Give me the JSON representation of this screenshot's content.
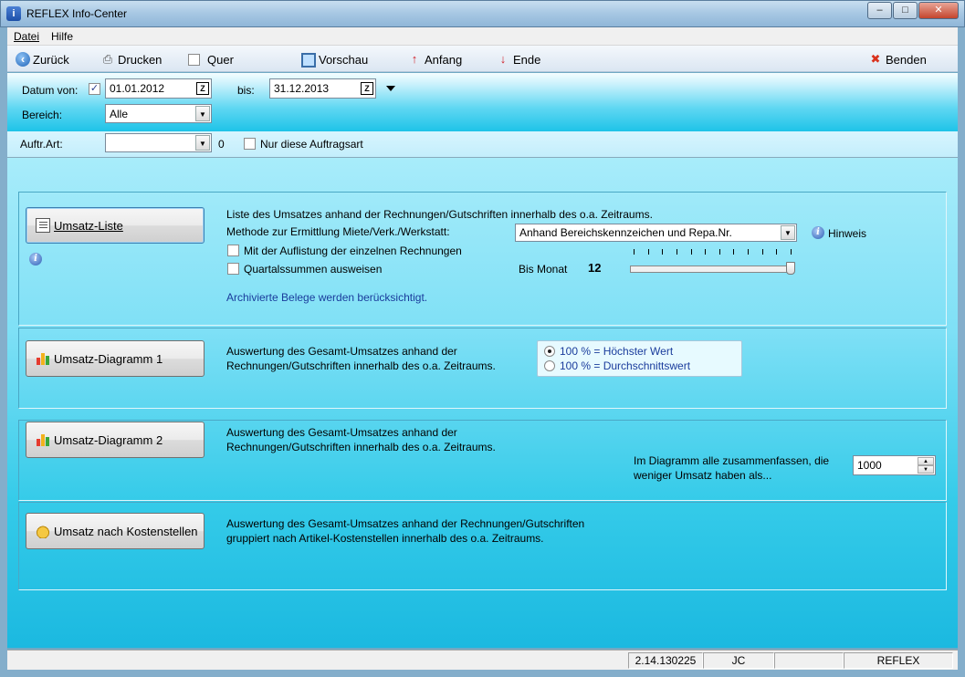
{
  "window": {
    "title": "REFLEX Info-Center",
    "icon_letter": "i",
    "controls": {
      "minimize": "–",
      "maximize": "□",
      "close": "✕"
    }
  },
  "menu": {
    "datei": "Datei",
    "hilfe": "Hilfe"
  },
  "toolbar": {
    "zurueck": "Zurück",
    "drucken": "Drucken",
    "quer": "Quer",
    "vorschau": "Vorschau",
    "anfang": "Anfang",
    "ende": "Ende",
    "benden": "Benden"
  },
  "filter": {
    "datum_von_label": "Datum von:",
    "datum_von_checked": "✓",
    "datum_von_value": "01.01.2012",
    "bis_label": "bis:",
    "bis_value": "31.12.2013",
    "cal_btn": "Z",
    "bereich_label": "Bereich:",
    "bereich_value": "Alle",
    "auftr_art_label": "Auftr.Art:",
    "auftr_art_value": "",
    "auftr_art_count": "0",
    "nur_diese_label": "Nur diese Auftragsart"
  },
  "sections": {
    "umsatz_liste": {
      "button": "Umsatz-Liste",
      "desc": "Liste des Umsatzes anhand der Rechnungen/Gutschriften innerhalb des o.a. Zeitraums.",
      "methode_label": "Methode zur Ermittlung Miete/Verk./Werkstatt:",
      "methode_value": "Anhand Bereichskennzeichen und Repa.Nr.",
      "hinweis": "Hinweis",
      "auflistung_label": "Mit der Auflistung der einzelnen Rechnungen",
      "quartal_label": "Quartalssummen ausweisen",
      "bis_monat_label": "Bis Monat",
      "bis_monat_value": "12",
      "archiv_note": "Archivierte Belege werden berücksichtigt."
    },
    "diagramm1": {
      "button": "Umsatz-Diagramm 1",
      "desc_line1": "Auswertung des Gesamt-Umsatzes anhand der",
      "desc_line2": "Rechnungen/Gutschriften innerhalb des o.a. Zeitraums.",
      "option1": "100 % = Höchster Wert",
      "option2": "100 % = Durchschnittswert"
    },
    "diagramm2": {
      "button": "Umsatz-Diagramm 2",
      "desc_line1": "Auswertung des Gesamt-Umsatzes anhand der",
      "desc_line2": "Rechnungen/Gutschriften innerhalb des o.a. Zeitraums.",
      "zusammen_line1": "Im Diagramm alle zusammenfassen, die",
      "zusammen_line2": "weniger Umsatz haben als...",
      "zusammen_value": "1000"
    },
    "kostenstellen": {
      "button": "Umsatz nach Kostenstellen",
      "desc_line1": "Auswertung des Gesamt-Umsatzes anhand der Rechnungen/Gutschriften",
      "desc_line2": "gruppiert nach Artikel-Kostenstellen innerhalb des o.a. Zeitraums."
    }
  },
  "status": {
    "version": "2.14.130225",
    "user": "JC",
    "empty": "",
    "app": "REFLEX"
  },
  "slider": {
    "value": 12,
    "max": 12
  },
  "colors": {
    "link_blue": "#1a3c9c",
    "panel_cyan": "#1bb9e0",
    "close_red": "#c4452d"
  }
}
